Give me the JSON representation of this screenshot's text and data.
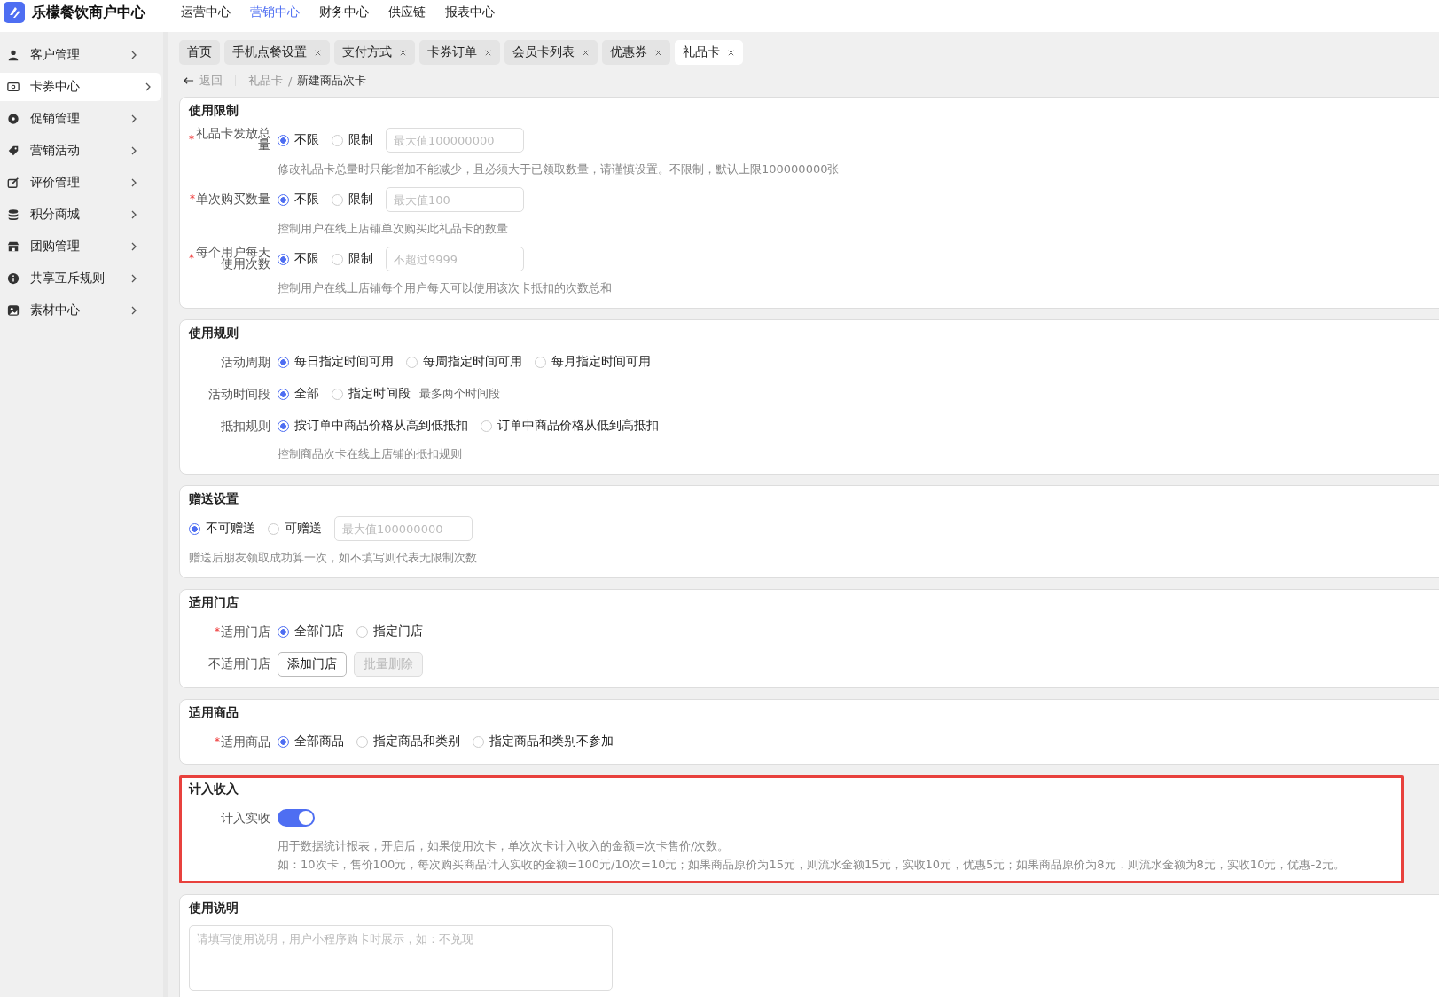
{
  "brand": {
    "name": "乐檬餐饮商户中心"
  },
  "top_nav": [
    {
      "label": "运营中心",
      "selected": false
    },
    {
      "label": "营销中心",
      "selected": true
    },
    {
      "label": "财务中心",
      "selected": false
    },
    {
      "label": "供应链",
      "selected": false
    },
    {
      "label": "报表中心",
      "selected": false
    }
  ],
  "sidebar": {
    "items": [
      {
        "label": "客户管理",
        "selected": false
      },
      {
        "label": "卡券中心",
        "selected": true
      },
      {
        "label": "促销管理",
        "selected": false
      },
      {
        "label": "营销活动",
        "selected": false
      },
      {
        "label": "评价管理",
        "selected": false
      },
      {
        "label": "积分商城",
        "selected": false
      },
      {
        "label": "团购管理",
        "selected": false
      },
      {
        "label": "共享互斥规则",
        "selected": false
      },
      {
        "label": "素材中心",
        "selected": false
      }
    ]
  },
  "tabs": [
    {
      "label": "首页",
      "closable": false,
      "selected": false
    },
    {
      "label": "手机点餐设置",
      "closable": true,
      "selected": false
    },
    {
      "label": "支付方式",
      "closable": true,
      "selected": false
    },
    {
      "label": "卡券订单",
      "closable": true,
      "selected": false
    },
    {
      "label": "会员卡列表",
      "closable": true,
      "selected": false
    },
    {
      "label": "优惠券",
      "closable": true,
      "selected": false
    },
    {
      "label": "礼品卡",
      "closable": true,
      "selected": true
    }
  ],
  "breadcrumb": {
    "back": "返回",
    "separator": "/",
    "items": [
      "礼品卡",
      "新建商品次卡"
    ]
  },
  "sections": [
    {
      "title": "使用限制",
      "highlighted": false,
      "rows": [
        {
          "kind": "radio",
          "required_mark": "*",
          "label": "礼品卡发放总量",
          "options": [
            {
              "label": "不限",
              "selected": true
            },
            {
              "label": "限制",
              "selected": false
            }
          ],
          "placeholder": "最大值100000000",
          "hints": [
            "修改礼品卡总量时只能增加不能减少，且必须大于已领取数量，请谨慎设置。不限制，默认上限100000000张"
          ]
        },
        {
          "kind": "radio",
          "required_mark": "*",
          "label": "单次购买数量",
          "options": [
            {
              "label": "不限",
              "selected": true
            },
            {
              "label": "限制",
              "selected": false
            }
          ],
          "placeholder": "最大值100",
          "hints": [
            "控制用户在线上店铺单次购买此礼品卡的数量"
          ]
        },
        {
          "kind": "radio",
          "required_mark": "*",
          "label": "每个用户每天使用次数",
          "options": [
            {
              "label": "不限",
              "selected": true
            },
            {
              "label": "限制",
              "selected": false
            }
          ],
          "placeholder": "不超过9999",
          "hints": [
            "控制用户在线上店铺每个用户每天可以使用该次卡抵扣的次数总和"
          ]
        }
      ]
    },
    {
      "title": "使用规则",
      "highlighted": false,
      "rows": [
        {
          "kind": "radio",
          "label": "活动周期",
          "options": [
            {
              "label": "每日指定时间可用",
              "selected": true
            },
            {
              "label": "每周指定时间可用",
              "selected": false
            },
            {
              "label": "每月指定时间可用",
              "selected": false
            }
          ]
        },
        {
          "kind": "radio",
          "label": "活动时间段",
          "options": [
            {
              "label": "全部",
              "selected": true
            },
            {
              "label": "指定时间段",
              "selected": false
            }
          ],
          "note": "最多两个时间段"
        },
        {
          "kind": "radio",
          "label": "抵扣规则",
          "options": [
            {
              "label": "按订单中商品价格从高到低抵扣",
              "selected": true
            },
            {
              "label": "订单中商品价格从低到高抵扣",
              "selected": false
            }
          ],
          "hints": [
            "控制商品次卡在线上店铺的抵扣规则"
          ]
        }
      ]
    },
    {
      "title": "赠送设置",
      "highlighted": false,
      "rows": [
        {
          "kind": "radio",
          "options": [
            {
              "label": "不可赠送",
              "selected": true
            },
            {
              "label": "可赠送",
              "selected": false
            }
          ],
          "placeholder": "最大值100000000",
          "hints": [
            "赠送后朋友领取成功算一次，如不填写则代表无限制次数"
          ]
        }
      ]
    },
    {
      "title": "适用门店",
      "highlighted": false,
      "rows": [
        {
          "kind": "radio",
          "required_mark": "*",
          "label": "适用门店",
          "options": [
            {
              "label": "全部门店",
              "selected": true
            },
            {
              "label": "指定门店",
              "selected": false
            }
          ]
        },
        {
          "kind": "buttons",
          "label": "不适用门店",
          "buttons": [
            {
              "label": "添加门店",
              "disabled": false
            },
            {
              "label": "批量删除",
              "disabled": true
            }
          ]
        }
      ]
    },
    {
      "title": "适用商品",
      "highlighted": false,
      "rows": [
        {
          "kind": "radio",
          "required_mark": "*",
          "label": "适用商品",
          "options": [
            {
              "label": "全部商品",
              "selected": true
            },
            {
              "label": "指定商品和类别",
              "selected": false
            },
            {
              "label": "指定商品和类别不参加",
              "selected": false
            }
          ]
        }
      ]
    },
    {
      "title": "计入收入",
      "highlighted": true,
      "rows": [
        {
          "kind": "toggle",
          "label": "计入实收",
          "on": true,
          "hints": [
            "用于数据统计报表，开启后，如果使用次卡，单次次卡计入收入的金额=次卡售价/次数。",
            "如：10次卡，售价100元，每次购买商品计入实收的金额=100元/10次=10元；如果商品原价为15元，则流水金额15元，实收10元，优惠5元；如果商品原价为8元，则流水金额为8元，实收10元，优惠-2元。"
          ]
        }
      ]
    },
    {
      "title": "使用说明",
      "highlighted": false,
      "rows": [
        {
          "kind": "textarea",
          "placeholder": "请填写使用说明，用户小程序购卡时展示，如：不兑现"
        }
      ]
    }
  ]
}
